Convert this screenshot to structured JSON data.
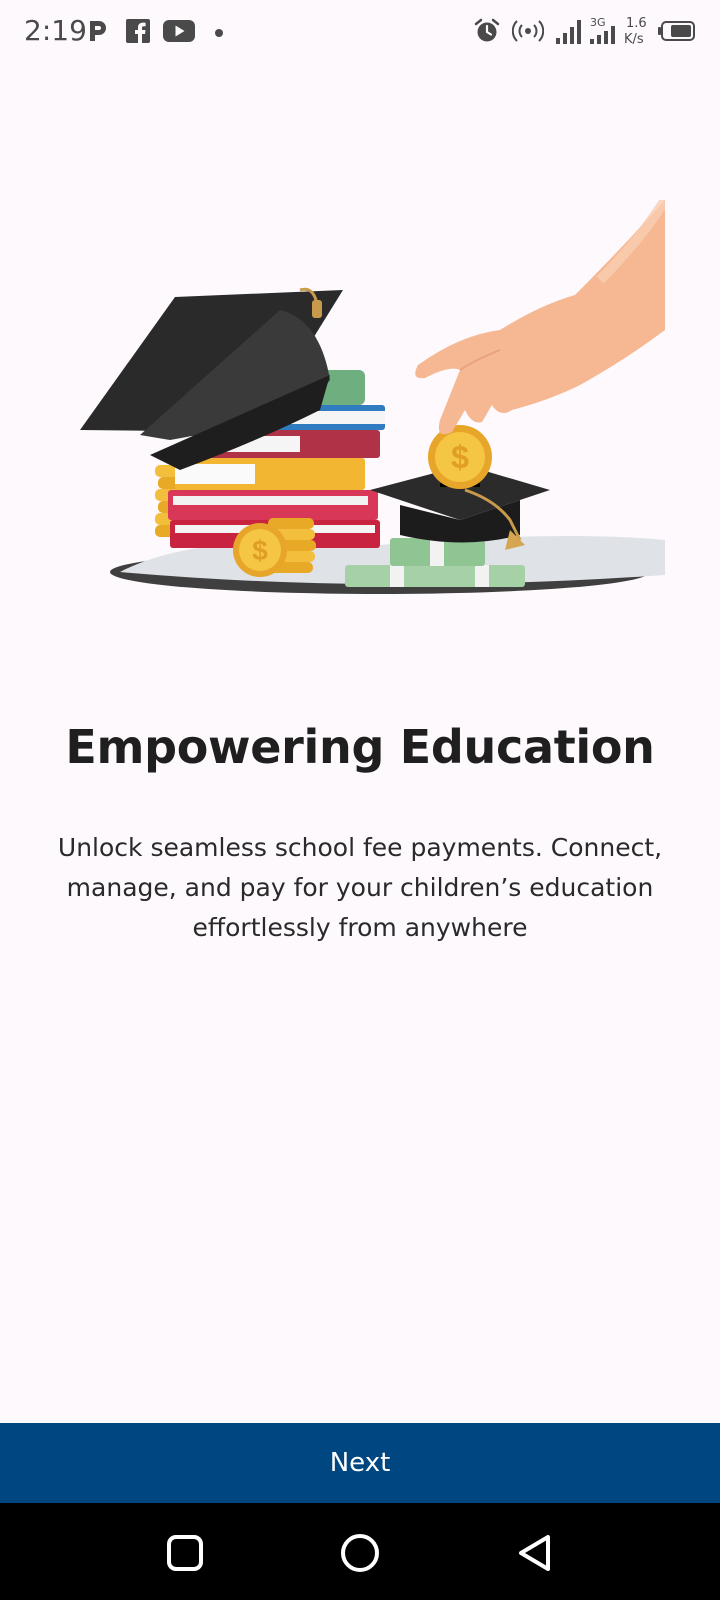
{
  "status_bar": {
    "time": "2:19",
    "network_speed_value": "1.6",
    "network_speed_unit": "K/s",
    "network_type": "3G",
    "icons": [
      "p-app-icon",
      "facebook-icon",
      "youtube-icon",
      "notification-dot-icon",
      "alarm-icon",
      "hotspot-icon",
      "signal-icon",
      "signal-3g-icon",
      "battery-icon"
    ]
  },
  "onboarding": {
    "title": "Empowering Education",
    "description": "Unlock seamless school fee payments. Connect, manage, and pay for your children’s education effortlessly from anywhere",
    "next_label": "Next"
  },
  "nav_bar": {
    "icons": [
      "recents-icon",
      "home-icon",
      "back-icon"
    ]
  },
  "colors": {
    "background": "#fdf9fc",
    "primary": "#004680",
    "text": "#1f1f1f"
  }
}
